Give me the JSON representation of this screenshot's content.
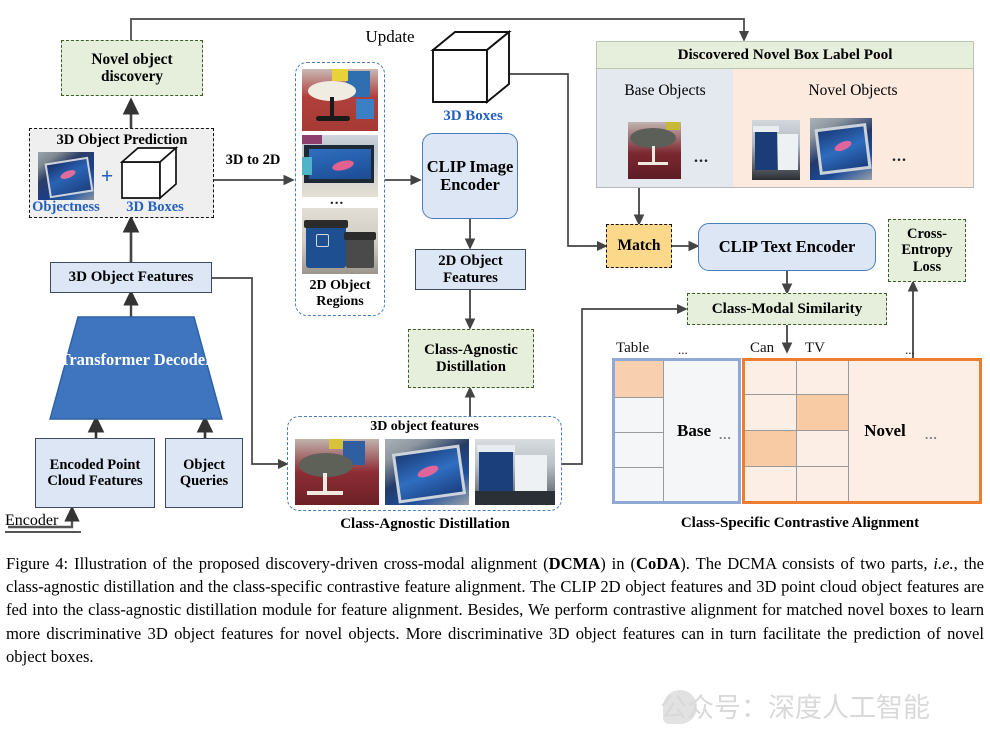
{
  "figure": {
    "label": "Figure 4:",
    "caption_html": "Figure 4: Illustration of the proposed discovery-driven cross-modal alignment (<b>DCMA</b>) in (<b>CoDA</b>). The DCMA consists of two parts, <i>i.e.</i>, the class-agnostic distillation and the class-specific contrastive feature alignment. The CLIP 2D object features and 3D point cloud object features are fed into the class-agnostic distillation module for feature alignment. Besides, We perform contrastive alignment for matched novel boxes to learn more discriminative 3D object features for novel objects. More discriminative 3D object features can in turn facilitate the prediction of novel object boxes."
  },
  "watermark": {
    "text": "公众号：深度人工智能"
  },
  "diagram": {
    "update_label": "Update",
    "encoder_label": "Encoder",
    "nodes": {
      "novel_object_discovery": "Novel object discovery",
      "object_prediction_title": "3D Object Prediction",
      "objectness": "Objectness",
      "prediction_plus": "+",
      "boxes_3d_inner": "3D Boxes",
      "three_d_to_two_d": "3D to 2D",
      "object_features_3d": "3D Object Features",
      "transformer_decoder": "Transformer Decoder",
      "encoded_point_cloud_features": "Encoded Point Cloud Features",
      "object_queries": "Object Queries",
      "two_d_object_regions": "2D Object Regions",
      "boxes_3d_top": "3D Boxes",
      "clip_image_encoder": "CLIP Image Encoder",
      "two_d_object_features": "2D Object Features",
      "class_agnostic_distillation_box": "Class-Agnostic Distillation",
      "three_d_object_features_panel": "3D object features",
      "class_agnostic_distillation_caption": "Class-Agnostic Distillation",
      "label_pool_title": "Discovered Novel Box Label Pool",
      "base_objects": "Base Objects",
      "novel_objects": "Novel Objects",
      "match": "Match",
      "clip_text_encoder": "CLIP Text Encoder",
      "cross_entropy_loss": "Cross-Entropy Loss",
      "class_modal_similarity": "Class-Modal Similarity",
      "class_specific_caption": "Class-Specific Contrastive Alignment",
      "base_matrix_label": "Base",
      "novel_matrix_label": "Novel",
      "ellipsis": "...",
      "ellipsis_small": "..."
    },
    "matrix": {
      "base_columns": [
        "Table",
        "..."
      ],
      "novel_columns": [
        "Can",
        "TV",
        "..."
      ],
      "base_highlight_cells": [
        [
          0,
          0
        ]
      ],
      "novel_highlight_cells": [
        [
          1,
          1
        ],
        [
          2,
          0
        ]
      ],
      "rows": 4
    },
    "colors": {
      "blue_fill": "#dce6f4",
      "blue_stroke": "#4a7ebb",
      "green_fill": "#e6efdc",
      "green_stroke": "#3e5c2a",
      "yellow_fill": "#fcd98a",
      "grey_fill": "#efefef",
      "decoder_fill": "#3f74bf",
      "base_panel": "#e4e8ef",
      "novel_panel": "#fdeade",
      "orange_stroke": "#ed7d31",
      "cell_highlight": "#f8d0b0",
      "cell_light": "#fceee4",
      "caption_blue": "#2460c0"
    }
  }
}
